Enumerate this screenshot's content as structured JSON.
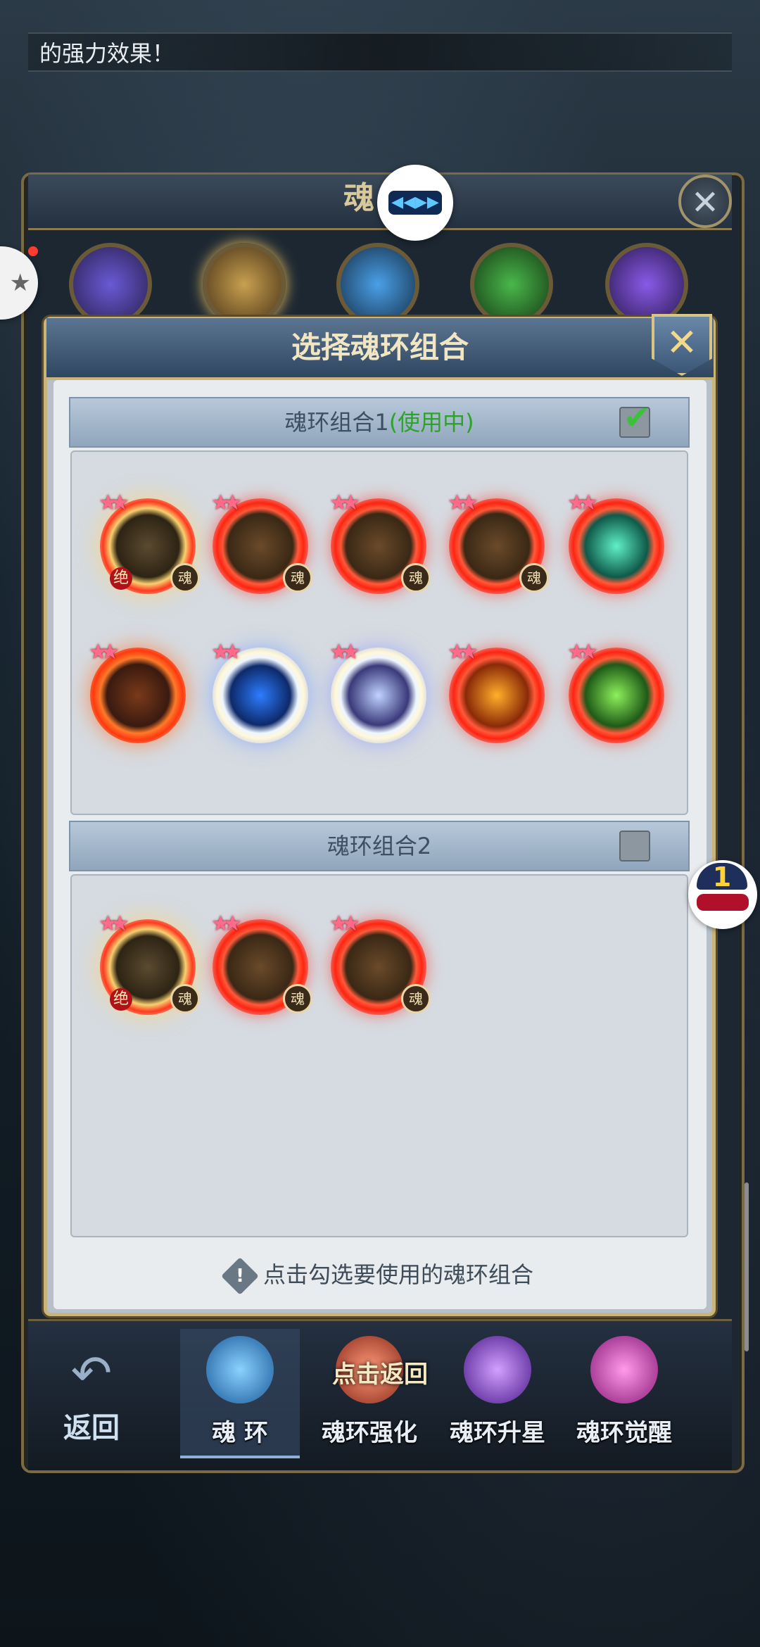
{
  "banner": {
    "text": "的强力效果！"
  },
  "outer_panel": {
    "title": "魂"
  },
  "dialog": {
    "title": "选择魂环组合",
    "close_icon": "close-x-icon",
    "group1": {
      "label": "魂环组合1",
      "status": "(使用中)",
      "checked": true,
      "rings": [
        {
          "style": "gold",
          "badge": "魂",
          "jue": "绝"
        },
        {
          "style": "red",
          "badge": "魂"
        },
        {
          "style": "red",
          "badge": "魂"
        },
        {
          "style": "red",
          "badge": "魂"
        },
        {
          "style": "teal-core"
        },
        {
          "style": "red-fire"
        },
        {
          "style": "ice"
        },
        {
          "style": "violet-core"
        },
        {
          "style": "flame-core"
        },
        {
          "style": "green-core"
        }
      ]
    },
    "group2": {
      "label": "魂环组合2",
      "checked": false,
      "rings": [
        {
          "style": "gold",
          "badge": "魂",
          "jue": "绝"
        },
        {
          "style": "red",
          "badge": "魂"
        },
        {
          "style": "red",
          "badge": "魂"
        }
      ]
    },
    "hint": "点击勾选要使用的魂环组合"
  },
  "bottom_menu": {
    "back_label": "返回",
    "return_hint": "点击返回",
    "tabs": [
      {
        "label": "魂 环",
        "active": true,
        "color": "#3a8bd6"
      },
      {
        "label": "魂环强化",
        "active": false,
        "color": "#c0503a"
      },
      {
        "label": "魂环升星",
        "active": false,
        "color": "#8a4ad6"
      },
      {
        "label": "魂环觉醒",
        "active": false,
        "color": "#c04aa8"
      }
    ]
  },
  "float_badge": {
    "count": "1"
  },
  "colors": {
    "accent_gold": "#c9b47a",
    "in_use_green": "#2ea22b"
  }
}
